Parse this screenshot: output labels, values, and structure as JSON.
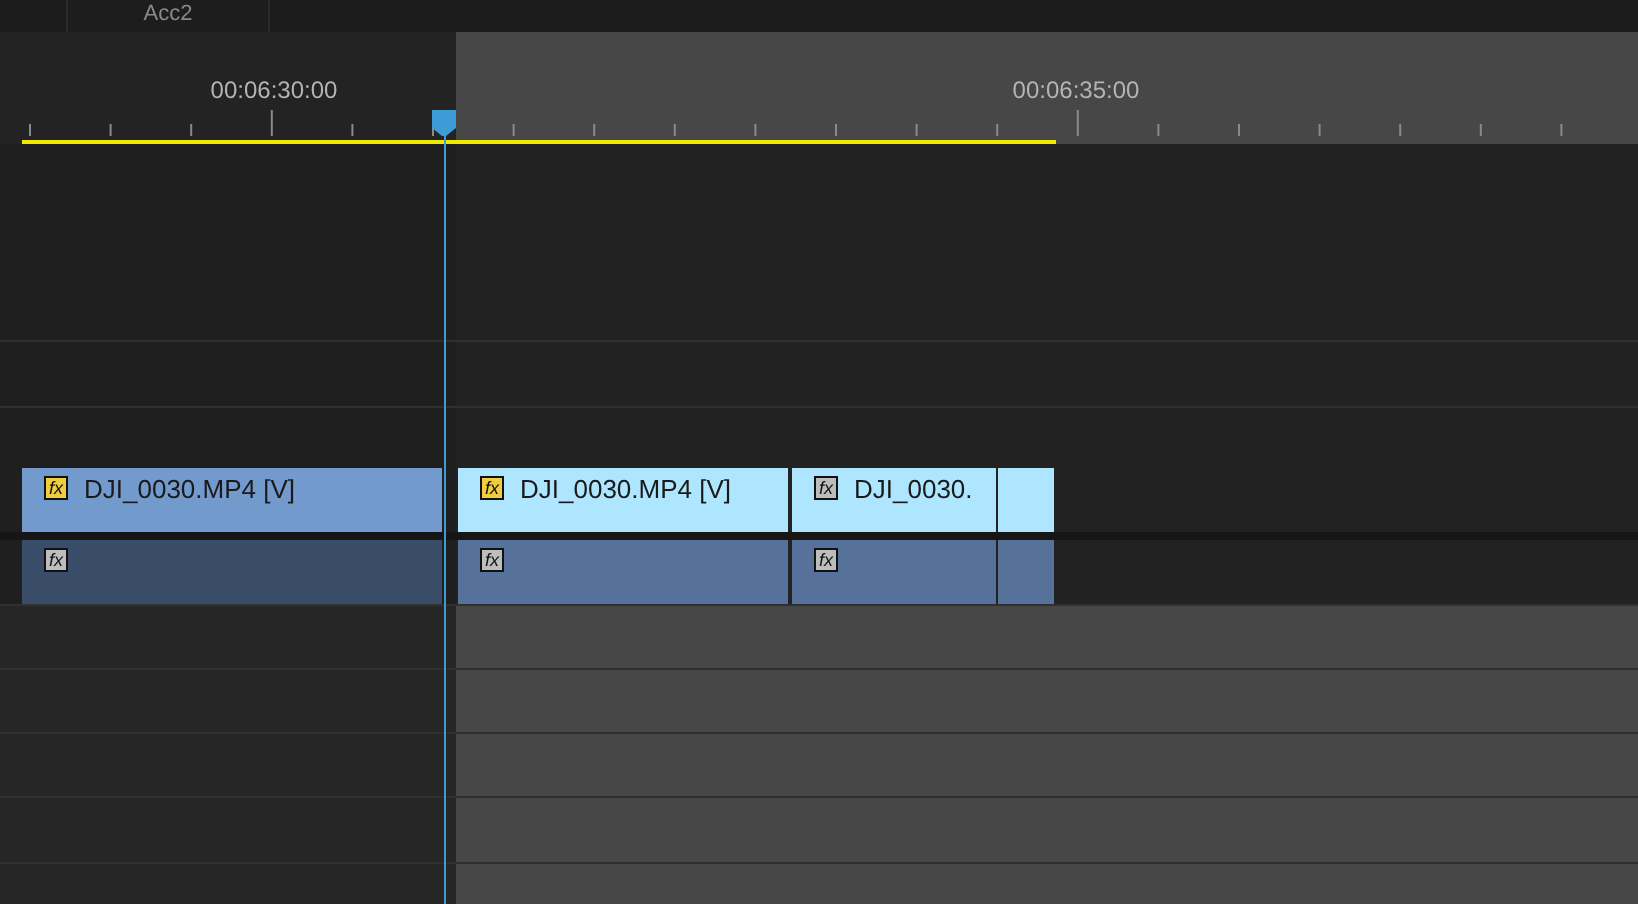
{
  "tab": {
    "label": "Acc2"
  },
  "ruler": {
    "timecodes": [
      "00:06:30:00",
      "00:06:35:00"
    ]
  },
  "video_track": {
    "clips": [
      {
        "name": "DJI_0030.MP4 [V]",
        "dimmed": true,
        "fx": "fx",
        "fx_applied": true
      },
      {
        "name": "DJI_0030.MP4 [V]",
        "dimmed": false,
        "fx": "fx",
        "fx_applied": true
      },
      {
        "name": "DJI_0030.",
        "dimmed": false,
        "fx": "fx",
        "fx_applied": false
      },
      {
        "dimmed": false
      }
    ]
  },
  "audio_track": {
    "clips": [
      {
        "dimmed": true,
        "fx": "fx",
        "fx_applied": false
      },
      {
        "dimmed": false,
        "fx": "fx",
        "fx_applied": false
      },
      {
        "dimmed": false,
        "fx": "fx",
        "fx_applied": false
      },
      {
        "dimmed": false
      }
    ]
  }
}
